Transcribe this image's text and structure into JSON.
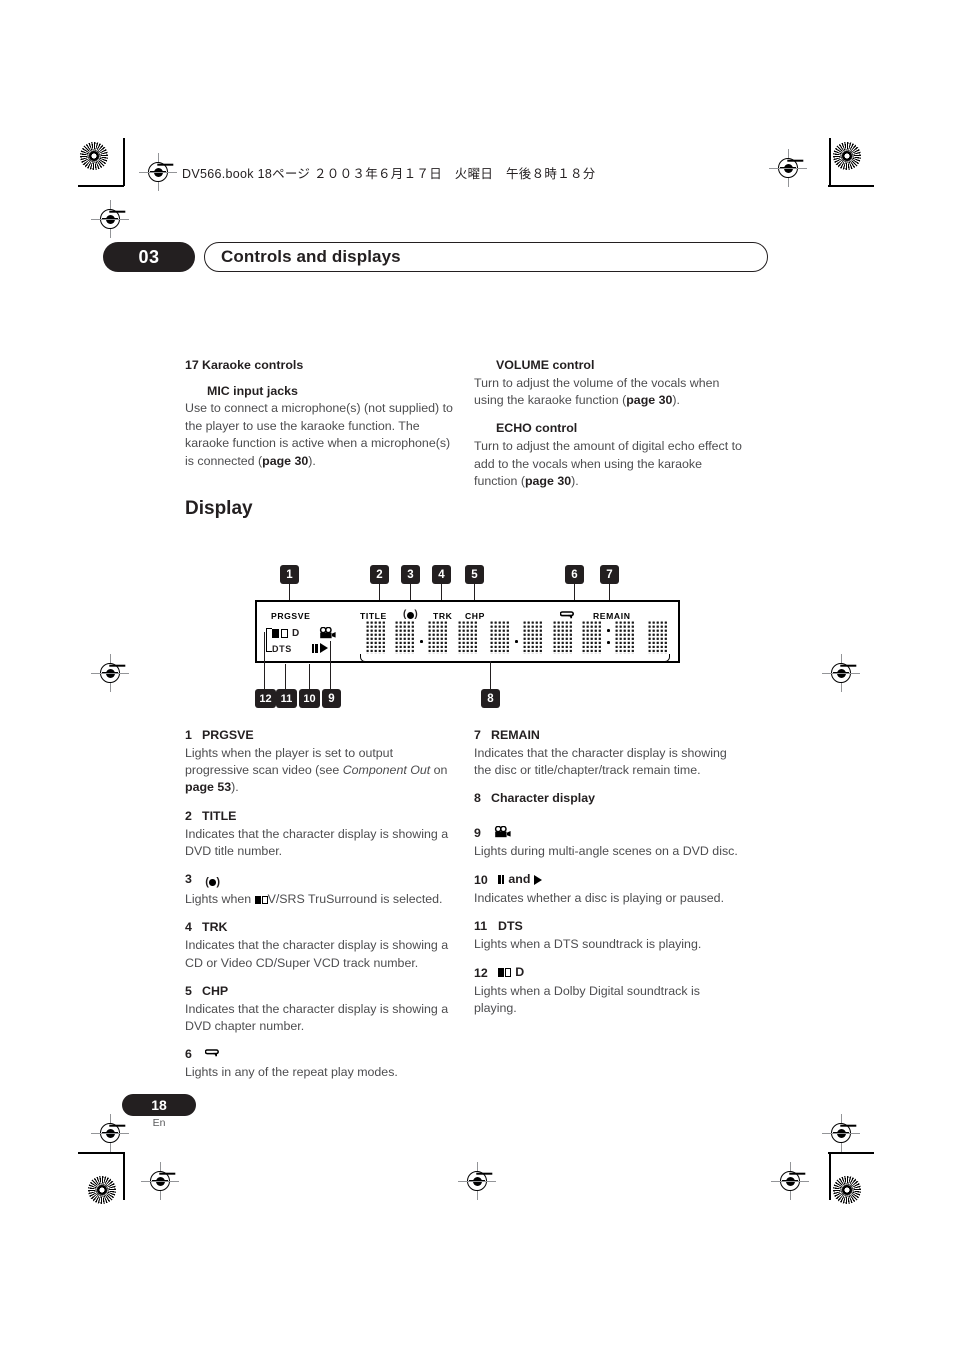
{
  "document": {
    "header_line": "DV566.book  18ページ  ２００３年６月１７日　火曜日　午後８時１８分",
    "chapter_number": "03",
    "chapter_title": "Controls and displays",
    "page_number": "18",
    "page_language": "En"
  },
  "karaoke_section": {
    "number": "17",
    "title": "Karaoke controls",
    "mic": {
      "label": "MIC input jacks",
      "text_before_page": "Use to connect a microphone(s) (not supplied) to the player to use the karaoke function. The karaoke function is active when a microphone(s) is connected (",
      "page_ref": "page 30",
      "text_after_page": ")."
    },
    "volume": {
      "label": "VOLUME control",
      "text_before_page": "Turn to adjust the volume of the vocals when using the karaoke function (",
      "page_ref": "page 30",
      "text_after_page": ")."
    },
    "echo": {
      "label": "ECHO control",
      "text_before_page": "Turn to adjust the amount of digital echo effect to add to the vocals when using the karaoke function (",
      "page_ref": "page 30",
      "text_after_page": ")."
    }
  },
  "display_section": {
    "heading": "Display",
    "panel": {
      "indicators": {
        "prgsve": "PRGSVE",
        "title": "TITLE",
        "trk": "TRK",
        "chp": "CHP",
        "remain": "REMAIN",
        "dts": "DTS",
        "dolby_d": "D",
        "virtual_surround": "(●)",
        "repeat": "repeat-loop-icon",
        "angle": "camera-icon",
        "pause": "pause-icon",
        "play": "play-icon"
      },
      "character_cell_count": 10
    },
    "callouts": [
      "1",
      "2",
      "3",
      "4",
      "5",
      "6",
      "7",
      "8",
      "9",
      "10",
      "11",
      "12"
    ]
  },
  "legend_left": [
    {
      "number": "1",
      "title": "PRGSVE",
      "body_1": "Lights when the player is set to output progressive scan video (see ",
      "italic": "Component Out",
      "body_2": " on ",
      "page_ref": "page 53",
      "body_3": ")."
    },
    {
      "number": "2",
      "title": "TITLE",
      "body_1": "Indicates that the character display is showing a DVD title number."
    },
    {
      "number": "3",
      "title": "(●)",
      "body_1": "Lights when ",
      "symbol": "DD",
      "body_2": "V/SRS TruSurround is selected."
    },
    {
      "number": "4",
      "title": "TRK",
      "body_1": "Indicates that the character display is showing a CD or Video CD/Super VCD track number."
    },
    {
      "number": "5",
      "title": "CHP",
      "body_1": "Indicates that the character display is showing a DVD chapter number."
    },
    {
      "number": "6",
      "title": "repeat-loop-icon",
      "body_1": "Lights in any of the repeat play modes."
    }
  ],
  "legend_right": [
    {
      "number": "7",
      "title": "REMAIN",
      "body_1": "Indicates that the character display is showing the disc or title/chapter/track remain time."
    },
    {
      "number": "8",
      "title": "Character display",
      "body_1": ""
    },
    {
      "number": "9",
      "title": "camera-icon",
      "body_1": "Lights during multi-angle scenes on a DVD disc."
    },
    {
      "number": "10",
      "title": "pause-and-play-icons",
      "title_text": "and",
      "body_1": "Indicates whether a disc is playing or paused."
    },
    {
      "number": "11",
      "title": "DTS",
      "body_1": "Lights when a DTS soundtrack is playing."
    },
    {
      "number": "12",
      "title": "dolby-digital-logo",
      "title_text": "D",
      "body_1": "Lights when a Dolby Digital soundtrack is playing."
    }
  ]
}
